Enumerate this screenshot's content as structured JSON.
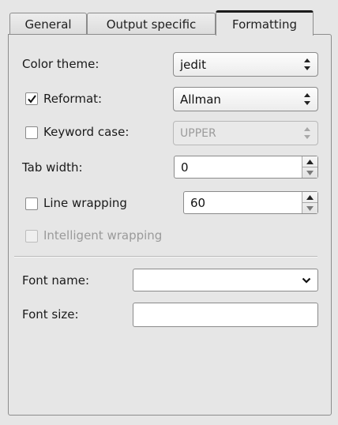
{
  "tabs": [
    {
      "label": "General",
      "active": false
    },
    {
      "label": "Output specific",
      "active": false
    },
    {
      "label": "Formatting",
      "active": true
    }
  ],
  "form": {
    "color_theme": {
      "label": "Color theme:",
      "value": "jedit"
    },
    "reformat": {
      "label": "Reformat:",
      "checked": true,
      "value": "Allman"
    },
    "keyword_case": {
      "label": "Keyword case:",
      "checked": false,
      "value": "UPPER",
      "enabled": false
    },
    "tab_width": {
      "label": "Tab width:",
      "value": "0"
    },
    "line_wrapping": {
      "label": "Line wrapping",
      "checked": false,
      "value": "60"
    },
    "intelligent_wrapping": {
      "label": "Intelligent wrapping",
      "checked": false,
      "enabled": false
    },
    "font_name": {
      "label": "Font name:",
      "value": ""
    },
    "font_size": {
      "label": "Font size:",
      "value": ""
    }
  },
  "icons": {
    "check": "check-icon",
    "updown": "updown-arrows-icon",
    "spin_up": "arrow-up-icon",
    "spin_down": "arrow-down-icon",
    "dropdown": "chevron-down-icon"
  }
}
